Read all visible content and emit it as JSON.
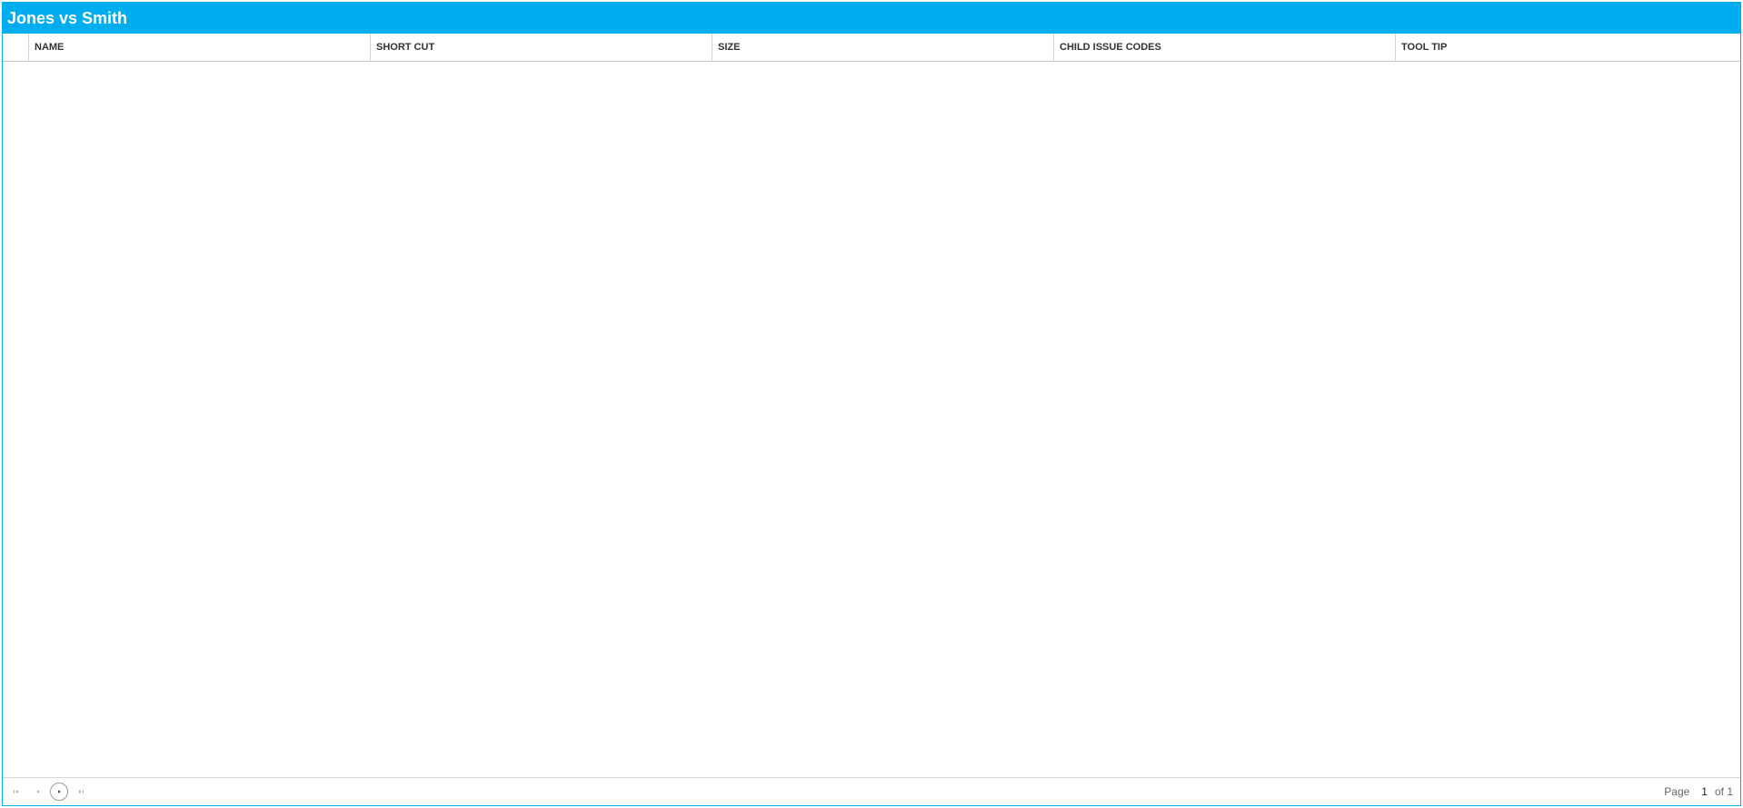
{
  "window": {
    "title": "Jones vs Smith"
  },
  "grid": {
    "columns": [
      {
        "label": "NAME"
      },
      {
        "label": "SHORT CUT"
      },
      {
        "label": "SIZE"
      },
      {
        "label": "CHILD ISSUE CODES"
      },
      {
        "label": "TOOL TIP"
      }
    ],
    "rows": []
  },
  "pager": {
    "page_label": "Page",
    "current_page": "1",
    "of_label": "of 1"
  },
  "colors": {
    "accent": "#00aeef",
    "header_text": "#333333",
    "border": "#d6d6d6"
  },
  "icons": {
    "first": "first-page-icon",
    "prev": "previous-page-icon",
    "next": "next-page-icon",
    "last": "last-page-icon"
  }
}
